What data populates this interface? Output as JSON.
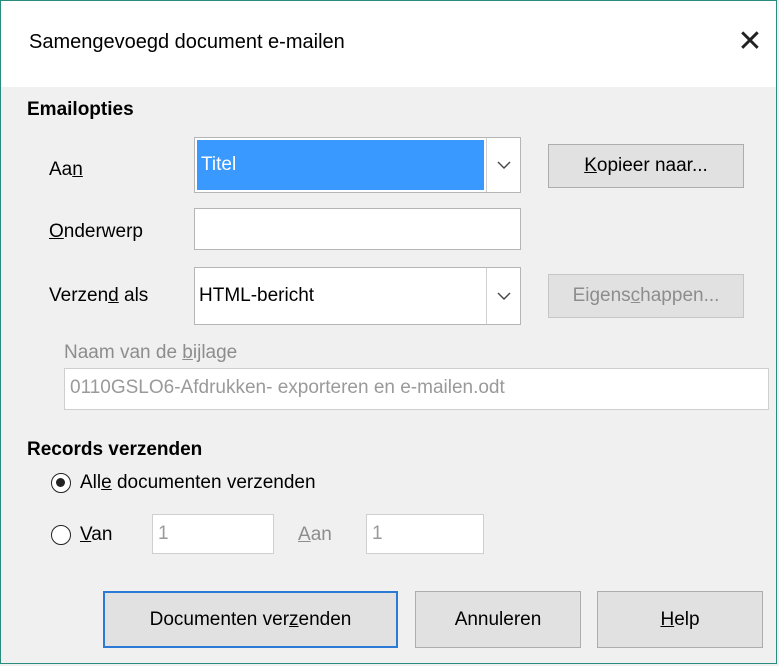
{
  "window": {
    "title": "Samengevoegd document e-mailen",
    "close_glyph": "✕"
  },
  "email_options": {
    "section_title": "Emailopties",
    "to": {
      "label_pre": "Aa",
      "label_u": "n",
      "label_post": "",
      "value": "Titel"
    },
    "copy_to_button": {
      "label_pre": "",
      "label_u": "K",
      "label_post": "opieer naar..."
    },
    "subject": {
      "label_pre": "",
      "label_u": "O",
      "label_post": "nderwerp",
      "value": ""
    },
    "send_as": {
      "label_pre": "Verzen",
      "label_u": "d",
      "label_post": " als",
      "value": "HTML-bericht"
    },
    "properties_button": {
      "label_pre": "Eigens",
      "label_u": "c",
      "label_post": "happen..."
    },
    "attachment": {
      "label_pre": "Naam van de ",
      "label_u": "b",
      "label_post": "ijlage",
      "value": "0110GSLO6-Afdrukken- exporteren en e-mailen.odt"
    }
  },
  "send_records": {
    "section_title": "Records verzenden",
    "all": {
      "label_pre": "All",
      "label_u": "e",
      "label_post": " documenten verzenden",
      "checked": true
    },
    "from": {
      "label_pre": "",
      "label_u": "V",
      "label_post": "an",
      "checked": false,
      "value": "1"
    },
    "to": {
      "label_pre": "",
      "label_u": "A",
      "label_post": "an",
      "value": "1"
    }
  },
  "buttons": {
    "send": {
      "label_pre": "Documenten ver",
      "label_u": "z",
      "label_post": "enden"
    },
    "cancel": {
      "label": "Annuleren"
    },
    "help": {
      "label_pre": "",
      "label_u": "H",
      "label_post": "elp"
    }
  },
  "colors": {
    "accent": "#2a7ad6",
    "selection": "#3999ff",
    "window_border": "#2a8c7c"
  }
}
